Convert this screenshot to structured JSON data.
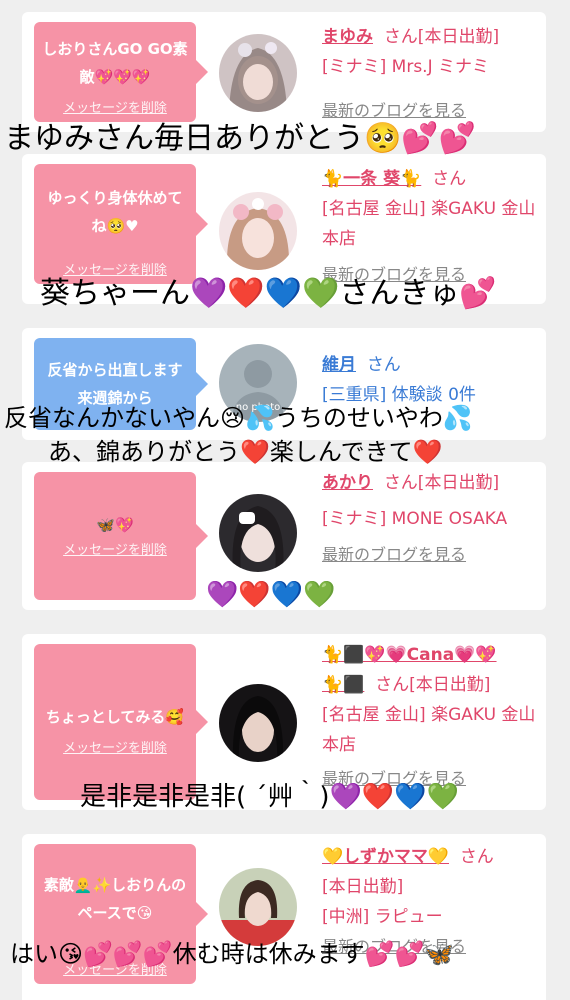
{
  "cards": [
    {
      "bubble_text": "しおりさんGO GO素敵💖💖💖",
      "bubble_color": "#f693a6",
      "delete_label": "メッセージを削除",
      "name": "まゆみ",
      "suffix": "さん[本日出勤]",
      "shop": "[ミナミ] Mrs.J ミナミ",
      "blog_label": "最新のブログを見る"
    },
    {
      "bubble_text": "ゆっくり身体休めてね🥺♥",
      "bubble_color": "#f693a6",
      "delete_label": "メッセージを削除",
      "name": "🐈一条 葵🐈",
      "suffix": "さん",
      "shop": "[名古屋 金山] 楽GAKU 金山本店",
      "blog_label": "最新のブログを見る"
    },
    {
      "bubble_text": "反省から出直します来週錦から",
      "bubble_color": "#7fb2f0",
      "avatar_text": "no photo",
      "name": "維月",
      "suffix": "さん",
      "shop": "[三重県] 体験談 0件"
    },
    {
      "bubble_text": "🦋💖",
      "bubble_color": "#f693a6",
      "delete_label": "メッセージを削除",
      "name": "あかり",
      "suffix": "さん[本日出勤]",
      "shop": "[ミナミ] MONE OSAKA",
      "blog_label": "最新のブログを見る"
    },
    {
      "bubble_text": "ちょっとしてみる🥰",
      "bubble_color": "#f693a6",
      "delete_label": "メッセージを削除",
      "name": "🐈⬛💖💗Cana💗💖",
      "name2": "🐈⬛",
      "suffix": "さん[本日出勤]",
      "shop": "[名古屋 金山] 楽GAKU 金山本店",
      "blog_label": "最新のブログを見る"
    },
    {
      "bubble_text": "素敵👨‍🦲✨しおりんのペースで😘",
      "bubble_color": "#f693a6",
      "delete_label": "メッセージを削除",
      "name": "💛しずかママ💛",
      "suffix": "さん",
      "status": "[本日出勤]",
      "shop": "[中洲] ラピュー",
      "blog_label": "最新のブログを見る"
    }
  ],
  "overlays": [
    "まゆみさん毎日ありがとう🥺💕💕",
    "葵ちゃーん💜❤️💙💚さんきゅ💕",
    "反省なんかないやん😢💦うちのせいやわ💦",
    "あ、錦ありがとう❤️楽しんできて❤️",
    "💜❤️💙💚",
    "是非是非是非( ´艸｀)💜❤️💙💚",
    "はい😘💕💕💕休む時は休みます💕💕🦋"
  ],
  "colors": {
    "name_pink": "#e0466a",
    "name_blue": "#3a7bd5",
    "bubble_pink": "#f693a6",
    "bubble_blue": "#7fb2f0",
    "card_bg": "#ffffff",
    "page_bg": "#efefef"
  }
}
